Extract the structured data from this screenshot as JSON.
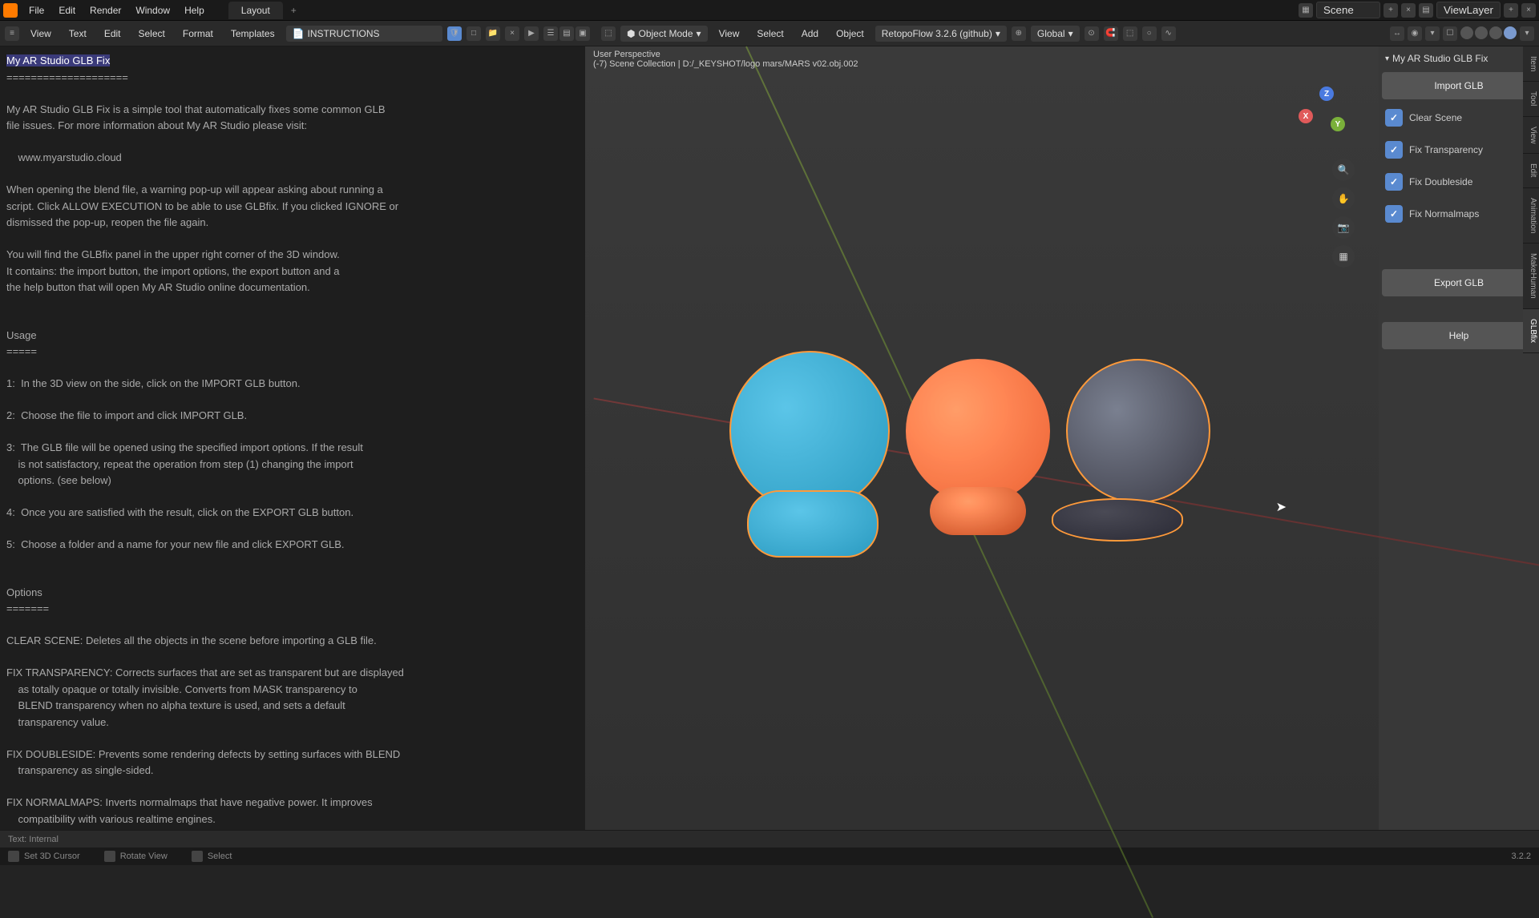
{
  "app_menu": {
    "file": "File",
    "edit": "Edit",
    "render": "Render",
    "window": "Window",
    "help": "Help"
  },
  "workspace": {
    "tab": "Layout"
  },
  "scene": {
    "field": "Scene",
    "viewlayer": "ViewLayer"
  },
  "text_header": {
    "menu_view": "View",
    "menu_text": "Text",
    "menu_edit": "Edit",
    "menu_select": "Select",
    "menu_format": "Format",
    "menu_templates": "Templates",
    "datablock": "INSTRUCTIONS"
  },
  "text_body": {
    "title": "My AR Studio GLB Fix",
    "sep1": "====================",
    "p1": "My AR Studio GLB Fix is a simple tool that automatically fixes some common GLB\nfile issues. For more information about My AR Studio please visit:",
    "url": "    www.myarstudio.cloud",
    "p2": "When opening the blend file, a warning pop-up will appear asking about running a\nscript. Click ALLOW EXECUTION to be able to use GLBfix. If you clicked IGNORE or\ndismissed the pop-up, reopen the file again.",
    "p3": "You will find the GLBfix panel in the upper right corner of the 3D window.\nIt contains: the import button, the import options, the export button and a\nthe help button that will open My AR Studio online documentation.",
    "usage_h": "Usage",
    "usage_sep": "=====",
    "u1": "1:  In the 3D view on the side, click on the IMPORT GLB button.",
    "u2": "2:  Choose the file to import and click IMPORT GLB.",
    "u3": "3:  The GLB file will be opened using the specified import options. If the result\n    is not satisfactory, repeat the operation from step (1) changing the import\n    options. (see below)",
    "u4": "4:  Once you are satisfied with the result, click on the EXPORT GLB button.",
    "u5": "5:  Choose a folder and a name for your new file and click EXPORT GLB.",
    "opts_h": "Options",
    "opts_sep": "=======",
    "o1": "CLEAR SCENE: Deletes all the objects in the scene before importing a GLB file.",
    "o2": "FIX TRANSPARENCY: Corrects surfaces that are set as transparent but are displayed\n    as totally opaque or totally invisible. Converts from MASK transparency to\n    BLEND transparency when no alpha texture is used, and sets a default\n    transparency value.",
    "o3": "FIX DOUBLESIDE: Prevents some rendering defects by setting surfaces with BLEND\n    transparency as single-sided.",
    "o4": "FIX NORMALMAPS: Inverts normalmaps that have negative power. It improves\n    compatibility with various realtime engines."
  },
  "viewport": {
    "persp": "User Perspective",
    "collection": "(-7) Scene Collection | D:/_KEYSHOT/logo mars/MARS v02.obj.002",
    "menu_view": "View",
    "menu_select": "Select",
    "menu_add": "Add",
    "menu_object": "Object",
    "mode": "Object Mode",
    "retopo": "RetopoFlow 3.2.6 (github)",
    "orient": "Global"
  },
  "panel": {
    "title": "My AR Studio GLB Fix",
    "import_btn": "Import GLB",
    "cb1": "Clear Scene",
    "cb2": "Fix Transparency",
    "cb3": "Fix Doubleside",
    "cb4": "Fix Normalmaps",
    "export_btn": "Export GLB",
    "help_btn": "Help"
  },
  "vert_tabs": {
    "t1": "Item",
    "t2": "Tool",
    "t3": "View",
    "t4": "Edit",
    "t5": "Animation",
    "t6": "MakeHuman",
    "t7": "GLBfix"
  },
  "bottom": {
    "text_info": "Text: Internal"
  },
  "status": {
    "s1": "Set 3D Cursor",
    "s2": "Rotate View",
    "s3": "Select",
    "version": "3.2.2"
  },
  "gizmo": {
    "x": "X",
    "y": "Y",
    "z": "Z"
  }
}
